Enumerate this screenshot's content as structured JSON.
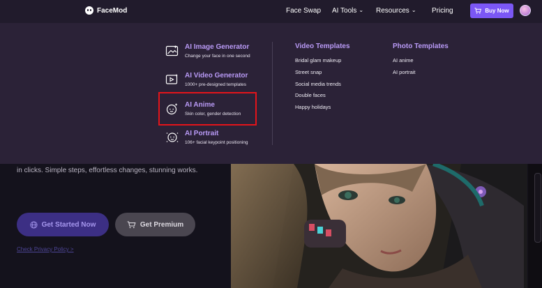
{
  "header": {
    "logo": "FaceMod",
    "nav": [
      "Face Swap",
      "AI Tools",
      "Resources",
      "Pricing"
    ],
    "buy_now": "Buy Now"
  },
  "menu": {
    "tools": [
      {
        "title": "AI Image Generator",
        "desc": "Change your face in one second",
        "icon": "image-generator-icon"
      },
      {
        "title": "AI Video Generator",
        "desc": "1000+ pre-designed templates",
        "icon": "video-generator-icon"
      },
      {
        "title": "AI Anime",
        "desc": "Skin color, gender detection",
        "icon": "anime-face-icon"
      },
      {
        "title": "AI Portrait",
        "desc": "106+ facial keypoint positioning",
        "icon": "portrait-icon"
      }
    ],
    "video_templates": {
      "title": "Video Templates",
      "items": [
        "Bridal glam makeup",
        "Street snap",
        "Social media trends",
        "Double faces",
        "Happy holidays"
      ]
    },
    "photo_templates": {
      "title": "Photo Templates",
      "items": [
        "AI anime",
        "AI portrait"
      ]
    }
  },
  "hero": {
    "text": "in clicks. Simple steps, effortless changes, stunning works.",
    "get_started": "Get Started Now",
    "get_premium": "Get Premium",
    "privacy": "Check Privacy Policy >"
  },
  "colors": {
    "accent": "#7b57f5",
    "menu_title": "#b99af6",
    "highlight": "#e4141a"
  }
}
